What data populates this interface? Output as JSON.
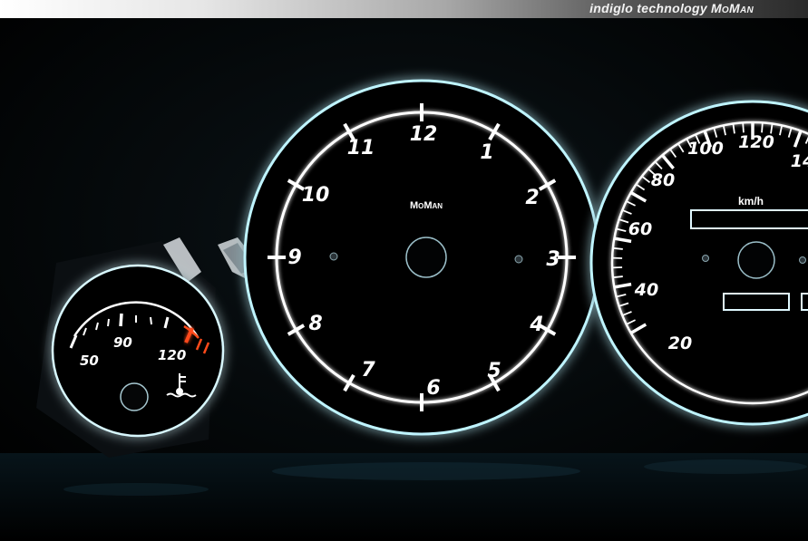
{
  "header": {
    "caption": "indiglo technology",
    "brand": "MoMan"
  },
  "temp_gauge": {
    "labels": [
      "50",
      "90",
      "120"
    ],
    "icon": "coolant-temperature-icon",
    "warning_color": "#ff4a1a"
  },
  "clock": {
    "brand": "MoMan",
    "hours": [
      "12",
      "1",
      "2",
      "3",
      "4",
      "5",
      "6",
      "7",
      "8",
      "9",
      "10",
      "11"
    ]
  },
  "speedometer": {
    "unit": "km/h",
    "labels": [
      "20",
      "40",
      "60",
      "80",
      "100",
      "120",
      "14"
    ],
    "warning_color": "#ff4a1a"
  },
  "colors": {
    "glow": "#7fe9ff",
    "dial_face": "#000000",
    "ring": "#ffffff",
    "accent": "#ff4a1a"
  }
}
